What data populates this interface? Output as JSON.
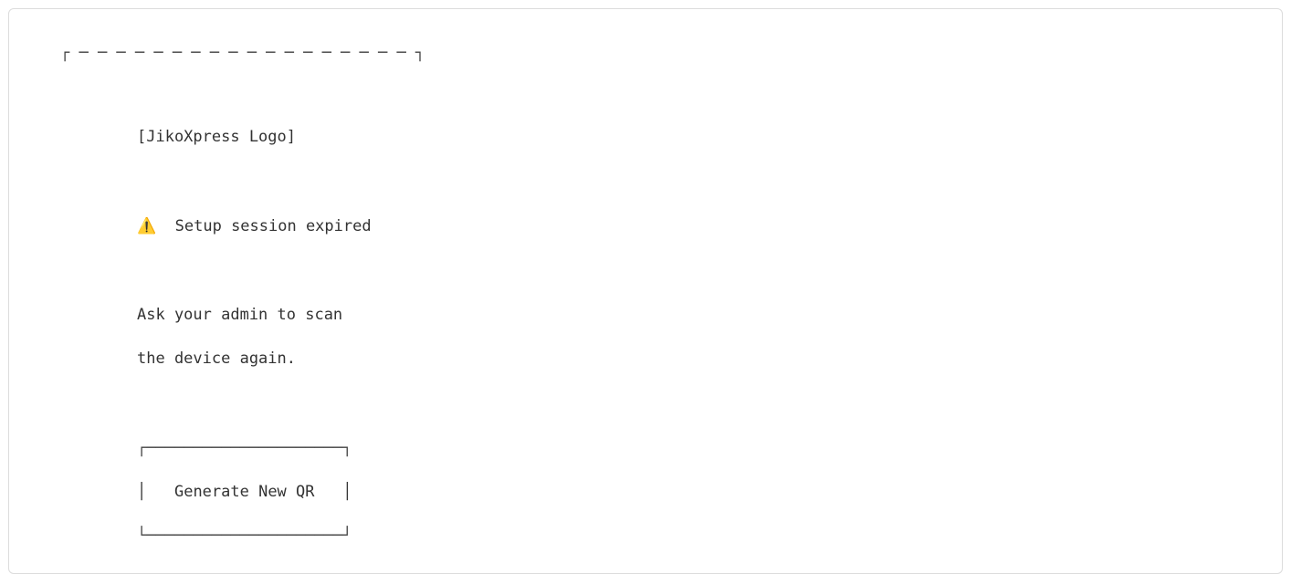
{
  "frame": {
    "top_border": "┌ ─ ─ ─ ─ ─ ─ ─ ─ ─ ─ ─ ─ ─ ─ ─ ─ ─ ─ ┐"
  },
  "logo": {
    "placeholder_text": "[JikoXpress Logo]"
  },
  "alert": {
    "icon": "⚠️",
    "icon_name": "warning-icon",
    "text": "Setup session expired"
  },
  "message": {
    "line1": "Ask your admin to scan",
    "line2": "the device again."
  },
  "button": {
    "border_top": "┌─────────────────────┐",
    "left_edge": "│",
    "label": "Generate New QR",
    "right_edge": "│",
    "border_bottom": "└─────────────────────┘"
  }
}
